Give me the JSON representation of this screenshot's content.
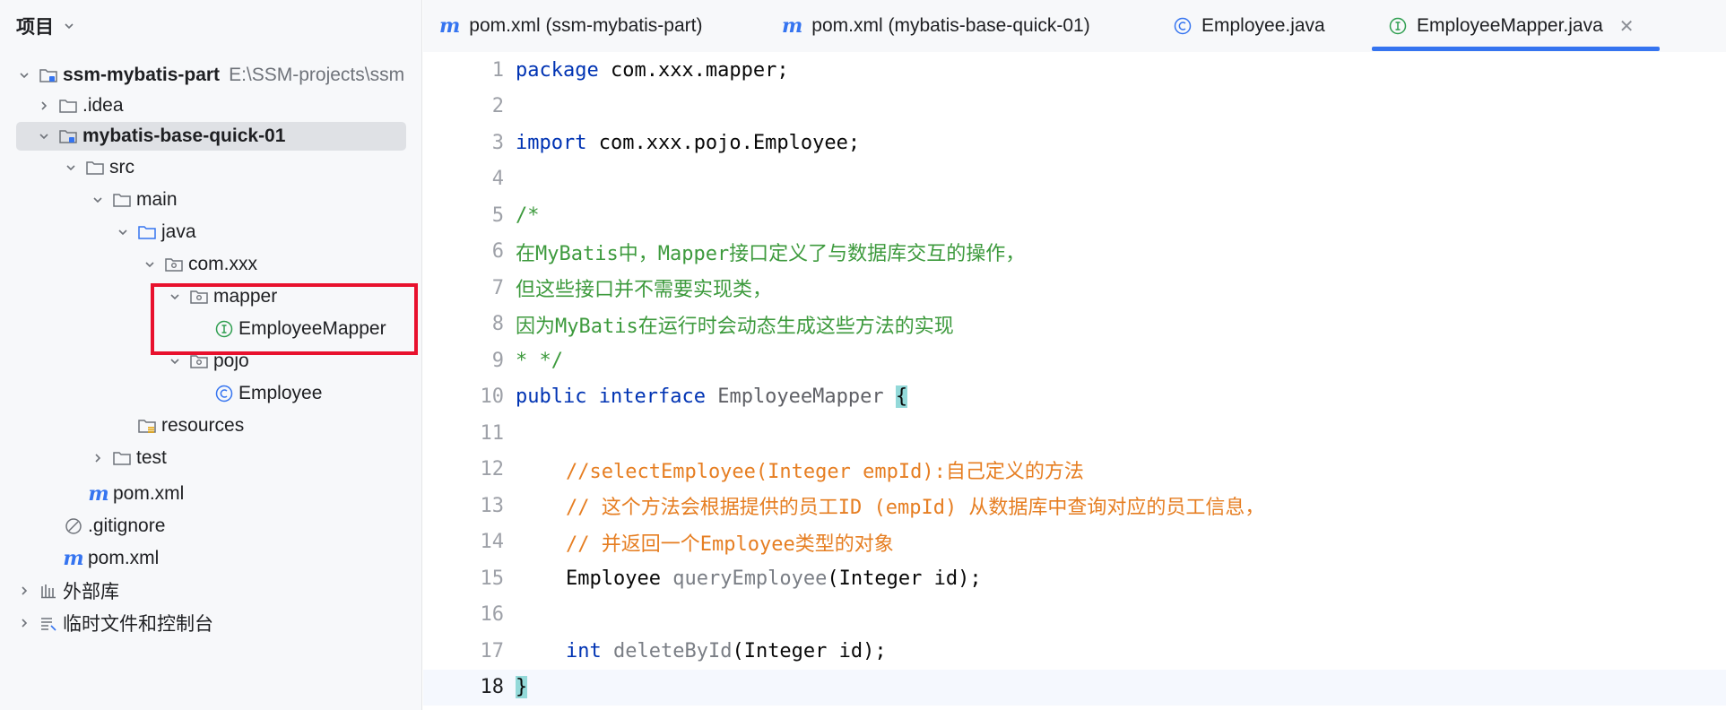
{
  "project_panel": {
    "title": "项目",
    "tree": [
      {
        "label": "ssm-mybatis-part",
        "path": "E:\\SSM-projects\\ssm"
      },
      {
        "label": ".idea"
      },
      {
        "label": "mybatis-base-quick-01"
      },
      {
        "label": "src"
      },
      {
        "label": "main"
      },
      {
        "label": "java"
      },
      {
        "label": "com.xxx"
      },
      {
        "label": "mapper"
      },
      {
        "label": "EmployeeMapper"
      },
      {
        "label": "pojo"
      },
      {
        "label": "Employee"
      },
      {
        "label": "resources"
      },
      {
        "label": "test"
      },
      {
        "label": "pom.xml"
      },
      {
        "label": ".gitignore"
      },
      {
        "label": "pom.xml"
      },
      {
        "label": "外部库"
      },
      {
        "label": "临时文件和控制台"
      }
    ],
    "maven_glyph": "m"
  },
  "tabs": [
    {
      "label": "pom.xml (ssm-mybatis-part)",
      "icon": "maven-icon"
    },
    {
      "label": "pom.xml (mybatis-base-quick-01)",
      "icon": "maven-icon"
    },
    {
      "label": "Employee.java",
      "icon": "class-icon"
    },
    {
      "label": "EmployeeMapper.java",
      "icon": "interface-icon",
      "active": true
    }
  ],
  "editor": {
    "line_numbers": [
      "1",
      "2",
      "3",
      "4",
      "5",
      "6",
      "7",
      "8",
      "9",
      "10",
      "11",
      "12",
      "13",
      "14",
      "15",
      "16",
      "17",
      "18"
    ],
    "tokens": {
      "l1_kw": "package",
      "l1_rest": " com.xxx.mapper;",
      "l3_kw": "import",
      "l3_rest": " com.xxx.pojo.Employee;",
      "l5": "/*",
      "l6": "在MyBatis中，Mapper接口定义了与数据库交互的操作，",
      "l7": "但这些接口并不需要实现类，",
      "l8": "因为MyBatis在运行时会动态生成这些方法的实现",
      "l9": "* */",
      "l10_kw1": "public",
      "l10_kw2": "interface",
      "l10_name": "EmployeeMapper",
      "l10_brace": "{",
      "l12": "//selectEmployee(Integer empId):自己定义的方法",
      "l13": "// 这个方法会根据提供的员工ID (empId) 从数据库中查询对应的员工信息，",
      "l14": "// 并返回一个Employee类型的对象",
      "l15_type": "Employee",
      "l15_method": "queryEmployee",
      "l15_rest": "(Integer id);",
      "l17_kw": "int",
      "l17_method": "deleteById",
      "l17_rest": "(Integer id);",
      "l18_brace": "}"
    }
  },
  "colors": {
    "keyword": "#0033b3",
    "block_comment": "#3d9a3d",
    "line_comment": "#e67e22",
    "highlight_box": "#e8112d",
    "tab_underline": "#3574f0"
  }
}
